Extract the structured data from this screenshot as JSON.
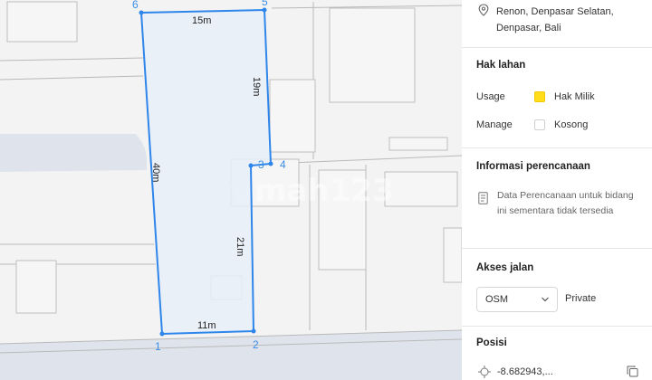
{
  "map": {
    "watermark": "rumah123",
    "vertices": [
      {
        "id": "1",
        "label": "1"
      },
      {
        "id": "2",
        "label": "2"
      },
      {
        "id": "3",
        "label": "3"
      },
      {
        "id": "4",
        "label": "4"
      },
      {
        "id": "5",
        "label": "5"
      },
      {
        "id": "6",
        "label": "6"
      }
    ],
    "edges": {
      "top": "15m",
      "right_upper": "19m",
      "left": "40m",
      "right_lower": "21m",
      "bottom": "11m"
    },
    "colors": {
      "outline": "#2f86ea",
      "fill": "#e8eef8",
      "road": "#dfe4ec"
    }
  },
  "panel": {
    "address": {
      "line1": "Renon, Denpasar Selatan,",
      "line2": "Denpasar, Bali"
    },
    "hak_lahan": {
      "title": "Hak lahan",
      "usage_label": "Usage",
      "usage_value": "Hak Milik",
      "usage_color": "#ffdd1a",
      "manage_label": "Manage",
      "manage_value": "Kosong"
    },
    "perencanaan": {
      "title": "Informasi perencanaan",
      "text": "Data Perencanaan untuk bidang ini sementara tidak tersedia"
    },
    "akses": {
      "title": "Akses jalan",
      "select_value": "OSM",
      "type": "Private"
    },
    "posisi": {
      "title": "Posisi",
      "coord": "-8.682943,..."
    }
  }
}
